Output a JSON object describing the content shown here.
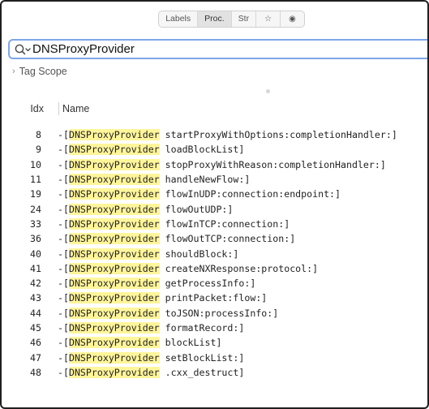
{
  "segments": [
    {
      "label": "Labels",
      "active": false
    },
    {
      "label": "Proc.",
      "active": true
    },
    {
      "label": "Str",
      "active": false
    },
    {
      "label": "☆",
      "active": false
    },
    {
      "label": "◉",
      "active": false
    }
  ],
  "search": {
    "value": "DNSProxyProvider",
    "icon": "search-icon"
  },
  "tag_scope": {
    "label": "Tag Scope",
    "icon": "chevron-right-icon"
  },
  "table": {
    "columns": {
      "idx": "Idx",
      "name": "Name"
    },
    "highlight": "DNSProxyProvider",
    "rows": [
      {
        "idx": "8",
        "prefix": "-[",
        "cls": "DNSProxyProvider",
        "rest": " startProxyWithOptions:completionHandler:]"
      },
      {
        "idx": "9",
        "prefix": "-[",
        "cls": "DNSProxyProvider",
        "rest": " loadBlockList]"
      },
      {
        "idx": "10",
        "prefix": "-[",
        "cls": "DNSProxyProvider",
        "rest": " stopProxyWithReason:completionHandler:]"
      },
      {
        "idx": "11",
        "prefix": "-[",
        "cls": "DNSProxyProvider",
        "rest": " handleNewFlow:]"
      },
      {
        "idx": "19",
        "prefix": "-[",
        "cls": "DNSProxyProvider",
        "rest": " flowInUDP:connection:endpoint:]"
      },
      {
        "idx": "24",
        "prefix": "-[",
        "cls": "DNSProxyProvider",
        "rest": " flowOutUDP:]"
      },
      {
        "idx": "33",
        "prefix": "-[",
        "cls": "DNSProxyProvider",
        "rest": " flowInTCP:connection:]"
      },
      {
        "idx": "36",
        "prefix": "-[",
        "cls": "DNSProxyProvider",
        "rest": " flowOutTCP:connection:]"
      },
      {
        "idx": "40",
        "prefix": "-[",
        "cls": "DNSProxyProvider",
        "rest": " shouldBlock:]"
      },
      {
        "idx": "41",
        "prefix": "-[",
        "cls": "DNSProxyProvider",
        "rest": " createNXResponse:protocol:]"
      },
      {
        "idx": "42",
        "prefix": "-[",
        "cls": "DNSProxyProvider",
        "rest": " getProcessInfo:]"
      },
      {
        "idx": "43",
        "prefix": "-[",
        "cls": "DNSProxyProvider",
        "rest": " printPacket:flow:]"
      },
      {
        "idx": "44",
        "prefix": "-[",
        "cls": "DNSProxyProvider",
        "rest": " toJSON:processInfo:]"
      },
      {
        "idx": "45",
        "prefix": "-[",
        "cls": "DNSProxyProvider",
        "rest": " formatRecord:]"
      },
      {
        "idx": "46",
        "prefix": "-[",
        "cls": "DNSProxyProvider",
        "rest": " blockList]"
      },
      {
        "idx": "47",
        "prefix": "-[",
        "cls": "DNSProxyProvider",
        "rest": " setBlockList:]"
      },
      {
        "idx": "48",
        "prefix": "-[",
        "cls": "DNSProxyProvider",
        "rest": " .cxx_destruct]"
      }
    ]
  },
  "colors": {
    "highlight": "#fff59a",
    "focus_ring": "#7ea6e8"
  }
}
